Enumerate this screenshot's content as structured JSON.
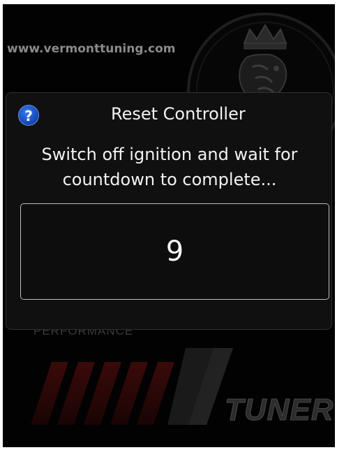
{
  "background": {
    "website": "www.vermonttuning.com",
    "performance_label": "PERFORMANCE",
    "tuner_label": "TUNER",
    "icons": [
      "griffin-badge-icon",
      "vm-tuner-logo-icon"
    ]
  },
  "dialog": {
    "icon": "question-icon",
    "icon_glyph": "?",
    "title": "Reset Controller",
    "message": "Switch off ignition and wait for countdown to complete...",
    "countdown": "9"
  },
  "colors": {
    "background": "#020202",
    "dialog_bg": "#101010",
    "text": "#f2f2f2",
    "help_icon": "#1a4fc4",
    "logo_accent": "#4a0e0e"
  }
}
